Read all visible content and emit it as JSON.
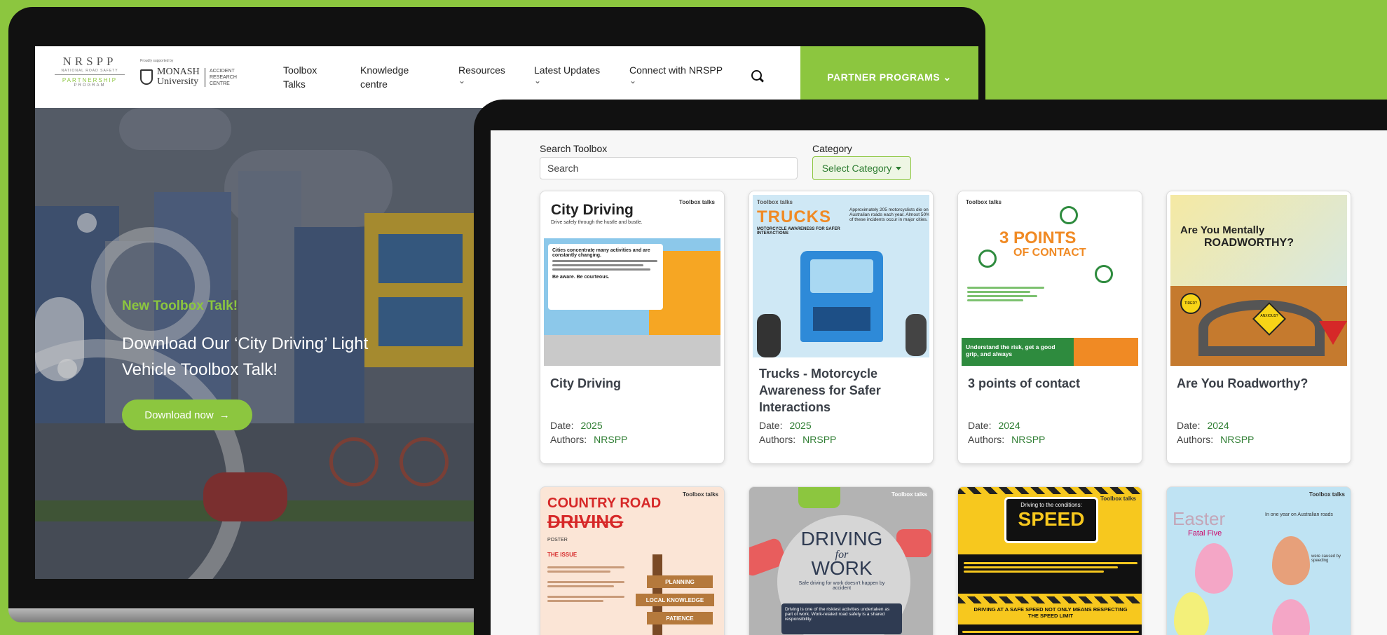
{
  "site": {
    "logo_main": "NRSPP",
    "logo_sub": "NATIONAL ROAD SAFETY",
    "logo_partnership": "PARTNERSHIP",
    "logo_program": "PROGRAM",
    "proudly_supported": "Proudly supported by",
    "monash_name": "MONASH University",
    "monash_centre": "ACCIDENT RESEARCH CENTRE",
    "nav": [
      {
        "label": "Toolbox Talks",
        "chev": ""
      },
      {
        "label": "Knowledge centre",
        "chev": ""
      },
      {
        "label": "Resources",
        "chev": "⌄"
      },
      {
        "label": "Latest Updates",
        "chev": "⌄"
      },
      {
        "label": "Connect with NRSPP",
        "chev": "⌄"
      }
    ],
    "partner_label": "PARTNER PROGRAMS ⌄"
  },
  "hero": {
    "tag": "New Toolbox Talk!",
    "title": "Download Our ‘City Driving’ Light Vehicle Toolbox Talk!",
    "button_label": "Download now",
    "button_arrow": "→"
  },
  "toolbox": {
    "search_label": "Search Toolbox",
    "search_placeholder": "Search",
    "category_label": "Category",
    "category_button": "Select Category",
    "date_label": "Date:",
    "authors_label": "Authors:",
    "cards": [
      {
        "title": "City Driving",
        "date": "2025",
        "authors": "NRSPP"
      },
      {
        "title": "Trucks - Motorcycle Awareness for Safer Interactions",
        "date": "2025",
        "authors": "NRSPP"
      },
      {
        "title": "3 points of contact",
        "date": "2024",
        "authors": "NRSPP"
      },
      {
        "title": "Are You Roadworthy?",
        "date": "2024",
        "authors": "NRSPP"
      }
    ]
  },
  "thumbs": {
    "city": {
      "head": "City Driving",
      "sub": "Drive safely through the hustle and bustle.",
      "box_title": "Cities concentrate many activities and are constantly changing.",
      "box_foot": "Be aware. Be courteous.",
      "tb": "Toolbox talks"
    },
    "trucks": {
      "head": "TRUCKS",
      "sub": "MOTORCYCLE AWARENESS FOR SAFER INTERACTIONS",
      "stat": "Approximately 205 motorcyclists die on Australian roads each year. Almost 50% of these incidents occur in major cities.",
      "tb": "Toolbox talks"
    },
    "points": {
      "head1": "3 POINTS",
      "head2": "OF CONTACT",
      "foot": "Understand the risk, get a good grip, and always",
      "tb": "Toolbox talks"
    },
    "roadworthy": {
      "head1": "Are You Mentally",
      "head2": "ROADWORTHY?",
      "sign1": "TIRED?",
      "sign2": "ANXIOUS?",
      "tb": "Toolbox talks"
    },
    "country": {
      "head1": "COUNTRY ROAD",
      "head2": "DRIVING",
      "poster": "POSTER",
      "issue": "THE ISSUE",
      "sign1": "PLANNING",
      "sign2": "LOCAL KNOWLEDGE",
      "sign3": "PATIENCE",
      "tb": "Toolbox talks"
    },
    "work": {
      "head1": "DRIVING",
      "head2": "for",
      "head3": "WORK",
      "sub": "Safe driving for work doesn't happen by accident",
      "box": "Driving is one of the riskiest activities undertaken as part of work. Work-related road safety is a shared responsibility.",
      "tb": "Toolbox talks"
    },
    "speed": {
      "head1": "Driving to the conditions:",
      "head2": "SPEED",
      "mid": "DRIVING AT A SAFE SPEED NOT ONLY MEANS RESPECTING THE SPEED LIMIT",
      "tb": "Toolbox talks"
    },
    "easter": {
      "head1": "Easter",
      "head2": "Fatal Five",
      "note1": "In one year on Australian roads",
      "note2": "were caused by speeding",
      "tb": "Toolbox talks"
    }
  },
  "colors": {
    "brand_green": "#8cc63f",
    "meta_green": "#2e7d32",
    "laptop_frame": "#111111"
  }
}
